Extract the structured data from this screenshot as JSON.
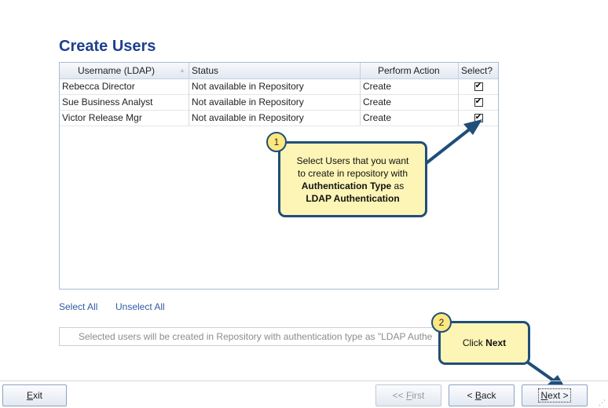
{
  "page": {
    "title": "Create Users"
  },
  "grid": {
    "columns": {
      "username": "Username (LDAP)",
      "status": "Status",
      "action": "Perform Action",
      "select": "Select?"
    },
    "rows": [
      {
        "username": "Rebecca Director",
        "status": "Not available in Repository",
        "action": "Create",
        "selected": true
      },
      {
        "username": "Sue Business Analyst",
        "status": "Not available in Repository",
        "action": "Create",
        "selected": true
      },
      {
        "username": "Victor Release Mgr",
        "status": "Not available in Repository",
        "action": "Create",
        "selected": true
      }
    ]
  },
  "links": {
    "select_all": "Select All",
    "unselect_all": "Unselect All"
  },
  "info": {
    "text": "Selected users will be created in Repository with authentication type as \"LDAP Authe"
  },
  "callouts": {
    "one": {
      "number": "1",
      "text_line1": "Select Users that you want",
      "text_line2": "to create in repository with",
      "bold1": "Authentication Type",
      "after_bold1": " as",
      "bold2": "LDAP Authentication"
    },
    "two": {
      "number": "2",
      "text": "Click ",
      "bold": "Next"
    }
  },
  "buttons": {
    "exit": {
      "mnemonic": "E",
      "rest": "xit"
    },
    "first": {
      "pre": "<< ",
      "mnemonic": "F",
      "rest": "irst"
    },
    "back": {
      "pre": "< ",
      "mnemonic": "B",
      "rest": "ack"
    },
    "next": {
      "mnemonic": "N",
      "rest": "ext >"
    }
  },
  "colors": {
    "title": "#1f3f8f",
    "callout_fill": "#fdf5b6",
    "callout_border": "#1f4e79",
    "link": "#2e5ba6"
  },
  "icons": {
    "sort": "sort-arrow-icon",
    "checkbox": "checkbox-checked-icon",
    "grip": "resize-grip-icon"
  }
}
